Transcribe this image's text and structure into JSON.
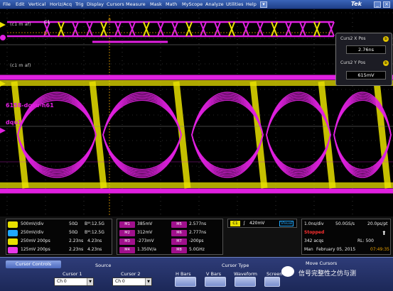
{
  "menu": {
    "items": [
      "File",
      "Edit",
      "Vertical",
      "Horiz/Acq",
      "Trig",
      "Display",
      "Cursors",
      "Measure",
      "Mask",
      "Math",
      "MyScope",
      "Analyze",
      "Utilities",
      "Help"
    ],
    "logo": "Tek"
  },
  "screen": {
    "top_label": "(c1 m af)",
    "c1_label": "C1",
    "top_marker_a": "a",
    "top_marker_b": "b",
    "mid_label": "(c1 m af)",
    "series_label_1": "6158-dqsu-h61",
    "series_label_2": "dqu1"
  },
  "cursor_box": {
    "x_pos_label": "Curs2 X Pos",
    "x_pos_value": "2.76ns",
    "y_pos_label": "Curs2 Y Pos",
    "y_pos_value": "615mV",
    "pin_x": "b",
    "pin_y": "b"
  },
  "channels": [
    {
      "name": "C1",
      "color": "#e8e000",
      "text": "500mV/div",
      "imp": "50Ω",
      "bw": "Bᵂ:12.5G"
    },
    {
      "name": "C2",
      "color": "#20a8ff",
      "text": "250mV/div",
      "imp": "50Ω",
      "bw": "Bᵂ:12.5G"
    },
    {
      "name": "Z1",
      "color": "#e8e000",
      "text": "250mV  200ps",
      "imp": "2.23ns",
      "bw": "4.23ns"
    },
    {
      "name": "Z2",
      "color": "#e838e8",
      "text": "125mV  200ps",
      "imp": "2.23ns",
      "bw": "4.23ns"
    }
  ],
  "measurements": {
    "left": [
      {
        "tag": "M1",
        "value": "385mV"
      },
      {
        "tag": "M2",
        "value": "312mV"
      },
      {
        "tag": "M3",
        "value": "-273mV"
      },
      {
        "tag": "M4",
        "value": "1.350V/a"
      }
    ],
    "right": [
      {
        "tag": "M5",
        "value": "2.577ns"
      },
      {
        "tag": "M6",
        "value": "2.777ns"
      },
      {
        "tag": "M7",
        "value": "-200ps"
      },
      {
        "tag": "M8",
        "value": "5.0GHz"
      }
    ]
  },
  "trigger": {
    "channel": "C1",
    "slope": "∫",
    "level": "420mV",
    "mode": "Visual"
  },
  "acquisition": {
    "rate_div": "1.0ns/div",
    "sample_rate": "50.0GS/s",
    "pt": "20.0ps/pt",
    "state": "Stopped",
    "acqs": "342 acqs",
    "rl": "RL: 500",
    "stamp_prefix": "Man",
    "date": "February 05, 2015",
    "time": "07:49:35"
  },
  "controls": {
    "title": "Cursor Controls",
    "source_label": "Source",
    "cursor1_label": "Cursor 1",
    "cursor1_value": "Ch 0",
    "cursor2_label": "Cursor 2",
    "cursor2_value": "Ch 0",
    "cursor_type_label": "Cursor Type",
    "types": [
      "H Bars",
      "V Bars",
      "Waveform",
      "Screen"
    ],
    "move_label": "Move Cursors"
  },
  "watermark": "信号完整性之仿与测",
  "colors": {
    "yellow": "#e8e000",
    "magenta": "#e020e0",
    "menu_blue": "#2a50a8"
  }
}
